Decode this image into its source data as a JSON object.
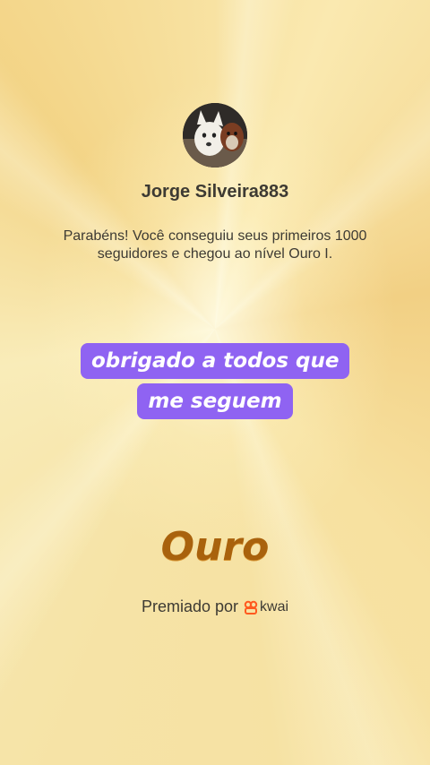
{
  "profile": {
    "username": "Jorge Silveira883"
  },
  "message": "Parabéns! Você conseguiu seus primeiros 1000 seguidores e chegou ao nível Ouro I.",
  "caption": "obrigado a todos que me seguem",
  "level": {
    "name": "Ouro"
  },
  "award": {
    "label": "Premiado por",
    "brand": "kwai",
    "brand_color": "#ff5a1f"
  },
  "colors": {
    "background": "#f4d98a",
    "caption_bg": "#8f63f2",
    "level_text": "#a9620d"
  }
}
